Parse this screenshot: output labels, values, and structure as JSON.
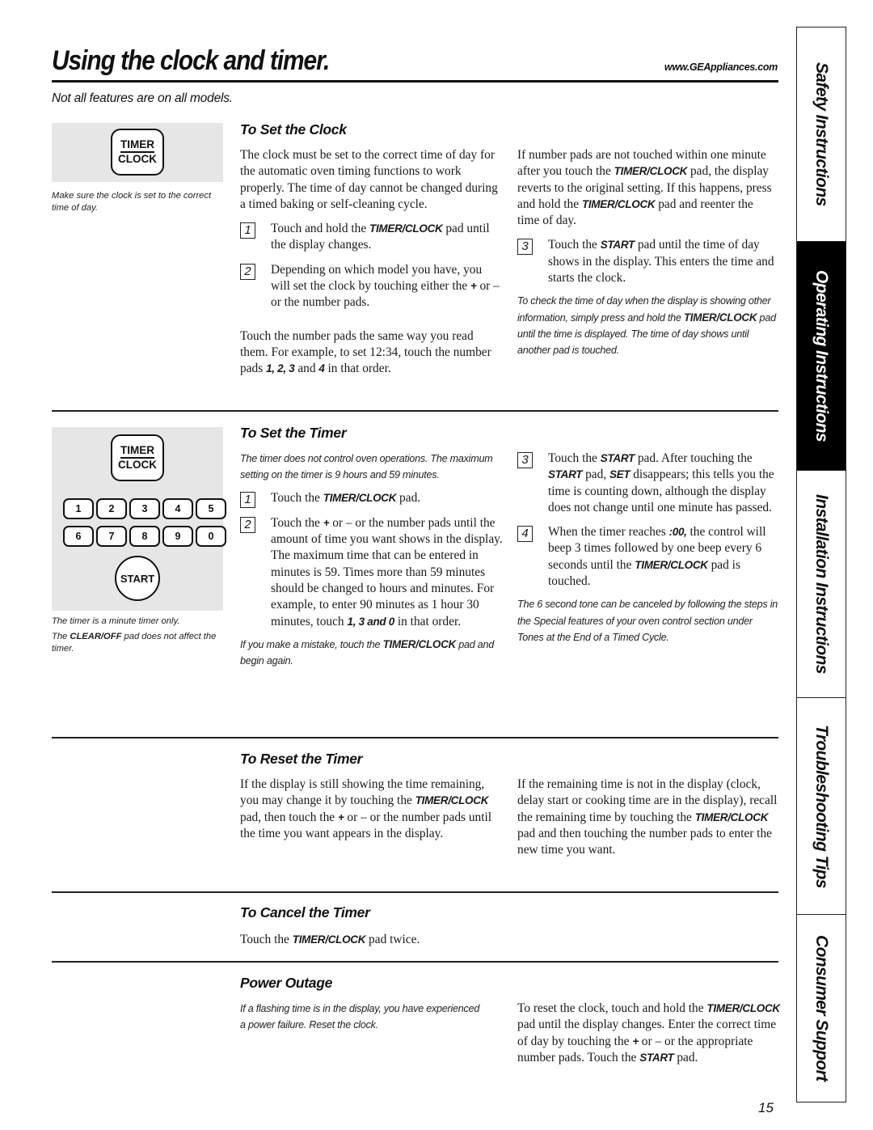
{
  "header": {
    "title": "Using the clock and timer.",
    "url": "www.GEAppliances.com",
    "subtitle": "Not all features are on all models."
  },
  "sidebar": {
    "tabs": [
      {
        "label": "Safety Instructions",
        "active": false
      },
      {
        "label": "Operating Instructions",
        "active": true
      },
      {
        "label": "Installation Instructions",
        "active": false
      },
      {
        "label": "Troubleshooting Tips",
        "active": false
      },
      {
        "label": "Consumer Support",
        "active": false
      }
    ]
  },
  "pads": {
    "timer_clock_top": "TIMER",
    "timer_clock_bottom": "CLOCK",
    "numbers_row1": [
      "1",
      "2",
      "3",
      "4",
      "5"
    ],
    "numbers_row2": [
      "6",
      "7",
      "8",
      "9",
      "0"
    ],
    "start": "START"
  },
  "set_clock": {
    "heading": "To Set the Clock",
    "caption": "Make sure the clock is set to the correct time of day.",
    "intro": "The clock must be set to the correct time of day for the automatic oven timing functions to work properly. The time of day cannot be changed during a timed baking or self-cleaning cycle.",
    "steps": [
      {
        "num": "1",
        "pre": "Touch and hold the ",
        "bold": "TIMER/CLOCK",
        "post": " pad until the display changes."
      },
      {
        "num": "2",
        "pre": "Depending on which model you have, you will set the clock by touching either the ",
        "bold": "+",
        "post": " or – or the number pads."
      },
      {
        "num": "3",
        "pre": "Touch the ",
        "bold": "START",
        "post": " pad until the time of day shows in the display. This enters the time and starts the clock."
      }
    ],
    "number_pads_text": {
      "pre": "Touch the number pads the same way you read them. For example, to set 12:34, touch the number pads ",
      "bold1": "1, 2, 3",
      "mid": " and ",
      "bold2": "4",
      "post": " in that order."
    },
    "timeout_text": {
      "pre": "If number pads are not touched within one minute after you touch the ",
      "bold1": "TIMER/CLOCK",
      "mid": " pad, the display reverts to the original setting. If this happens, press and hold the ",
      "bold2": "TIMER/CLOCK",
      "post": " pad and reenter the time of day."
    },
    "note": {
      "pre": "To check the time of day when the display is showing other information, simply press and hold the ",
      "bold": "TIMER/CLOCK",
      "post": " pad until the time is displayed. The time of day shows until another pad is touched."
    }
  },
  "set_timer": {
    "heading": "To Set the Timer",
    "caption1": "The timer is a minute timer only.",
    "caption2": {
      "pre": "The ",
      "bold": "CLEAR/OFF",
      "post": " pad does not affect the timer."
    },
    "intro": "The timer does not control oven operations. The maximum setting on the timer is 9 hours and 59 minutes.",
    "steps": [
      {
        "num": "1",
        "pre": "Touch the ",
        "bold": "TIMER/CLOCK",
        "post": " pad."
      },
      {
        "num": "2",
        "pre": "Touch the ",
        "bold": "+",
        "post": " or – or the number pads until the amount of time you want shows in the display. The maximum time that can be entered in minutes is 59. Times more than 59 minutes should be changed to hours and minutes. For example, to enter 90 minutes as 1 hour 30 minutes, touch ",
        "bold2": "1, 3 and 0",
        "post2": " in that order."
      },
      {
        "num": "3",
        "pre": "Touch the ",
        "bold": "START",
        "mid": " pad. After touching the ",
        "bold2": "START",
        "mid2": " pad, ",
        "bold3": "SET",
        "post": " disappears; this tells you the time is counting down, although the display does not change until one minute has passed."
      },
      {
        "num": "4",
        "pre": "When the timer reaches ",
        "bold": ":00,",
        "mid": " the control will beep 3 times followed by one beep every 6 seconds until the ",
        "bold2": "TIMER/CLOCK",
        "post": " pad is touched."
      }
    ],
    "mistake_note": {
      "pre": "If you make a mistake, touch the ",
      "bold": "TIMER/CLOCK",
      "post": " pad and begin again."
    },
    "tone_note": "The 6 second tone can be canceled by following the steps in the Special features of your oven control section under Tones at the End of a Timed Cycle."
  },
  "reset_timer": {
    "heading": "To Reset the Timer",
    "left": {
      "pre": "If the display is still showing the time remaining, you may change it by touching the ",
      "bold": "TIMER/CLOCK",
      "mid": " pad, then touch the ",
      "bold2": "+",
      "post": " or – or the number pads until the time you want appears in the display."
    },
    "right": {
      "pre": "If the remaining time is not in the display (clock, delay start or cooking time are in the display), recall the remaining time by touching the ",
      "bold": "TIMER/CLOCK",
      "post": " pad and then touching the number pads to enter the new time you want."
    }
  },
  "cancel_timer": {
    "heading": "To Cancel the Timer",
    "text": {
      "pre": "Touch the ",
      "bold": "TIMER/CLOCK",
      "post": " pad twice."
    }
  },
  "power_outage": {
    "heading": "Power Outage",
    "note": "If a flashing time is in the display, you have experienced a power failure. Reset the clock.",
    "text": {
      "pre": "To reset the clock, touch and hold the ",
      "bold": "TIMER/CLOCK",
      "mid": " pad until the display changes. Enter the correct time of day by touching the ",
      "bold2": "+",
      "mid2": " or – or the appropriate number pads. Touch the ",
      "bold3": "START",
      "post": " pad."
    }
  },
  "footer": {
    "page_number": "15"
  }
}
